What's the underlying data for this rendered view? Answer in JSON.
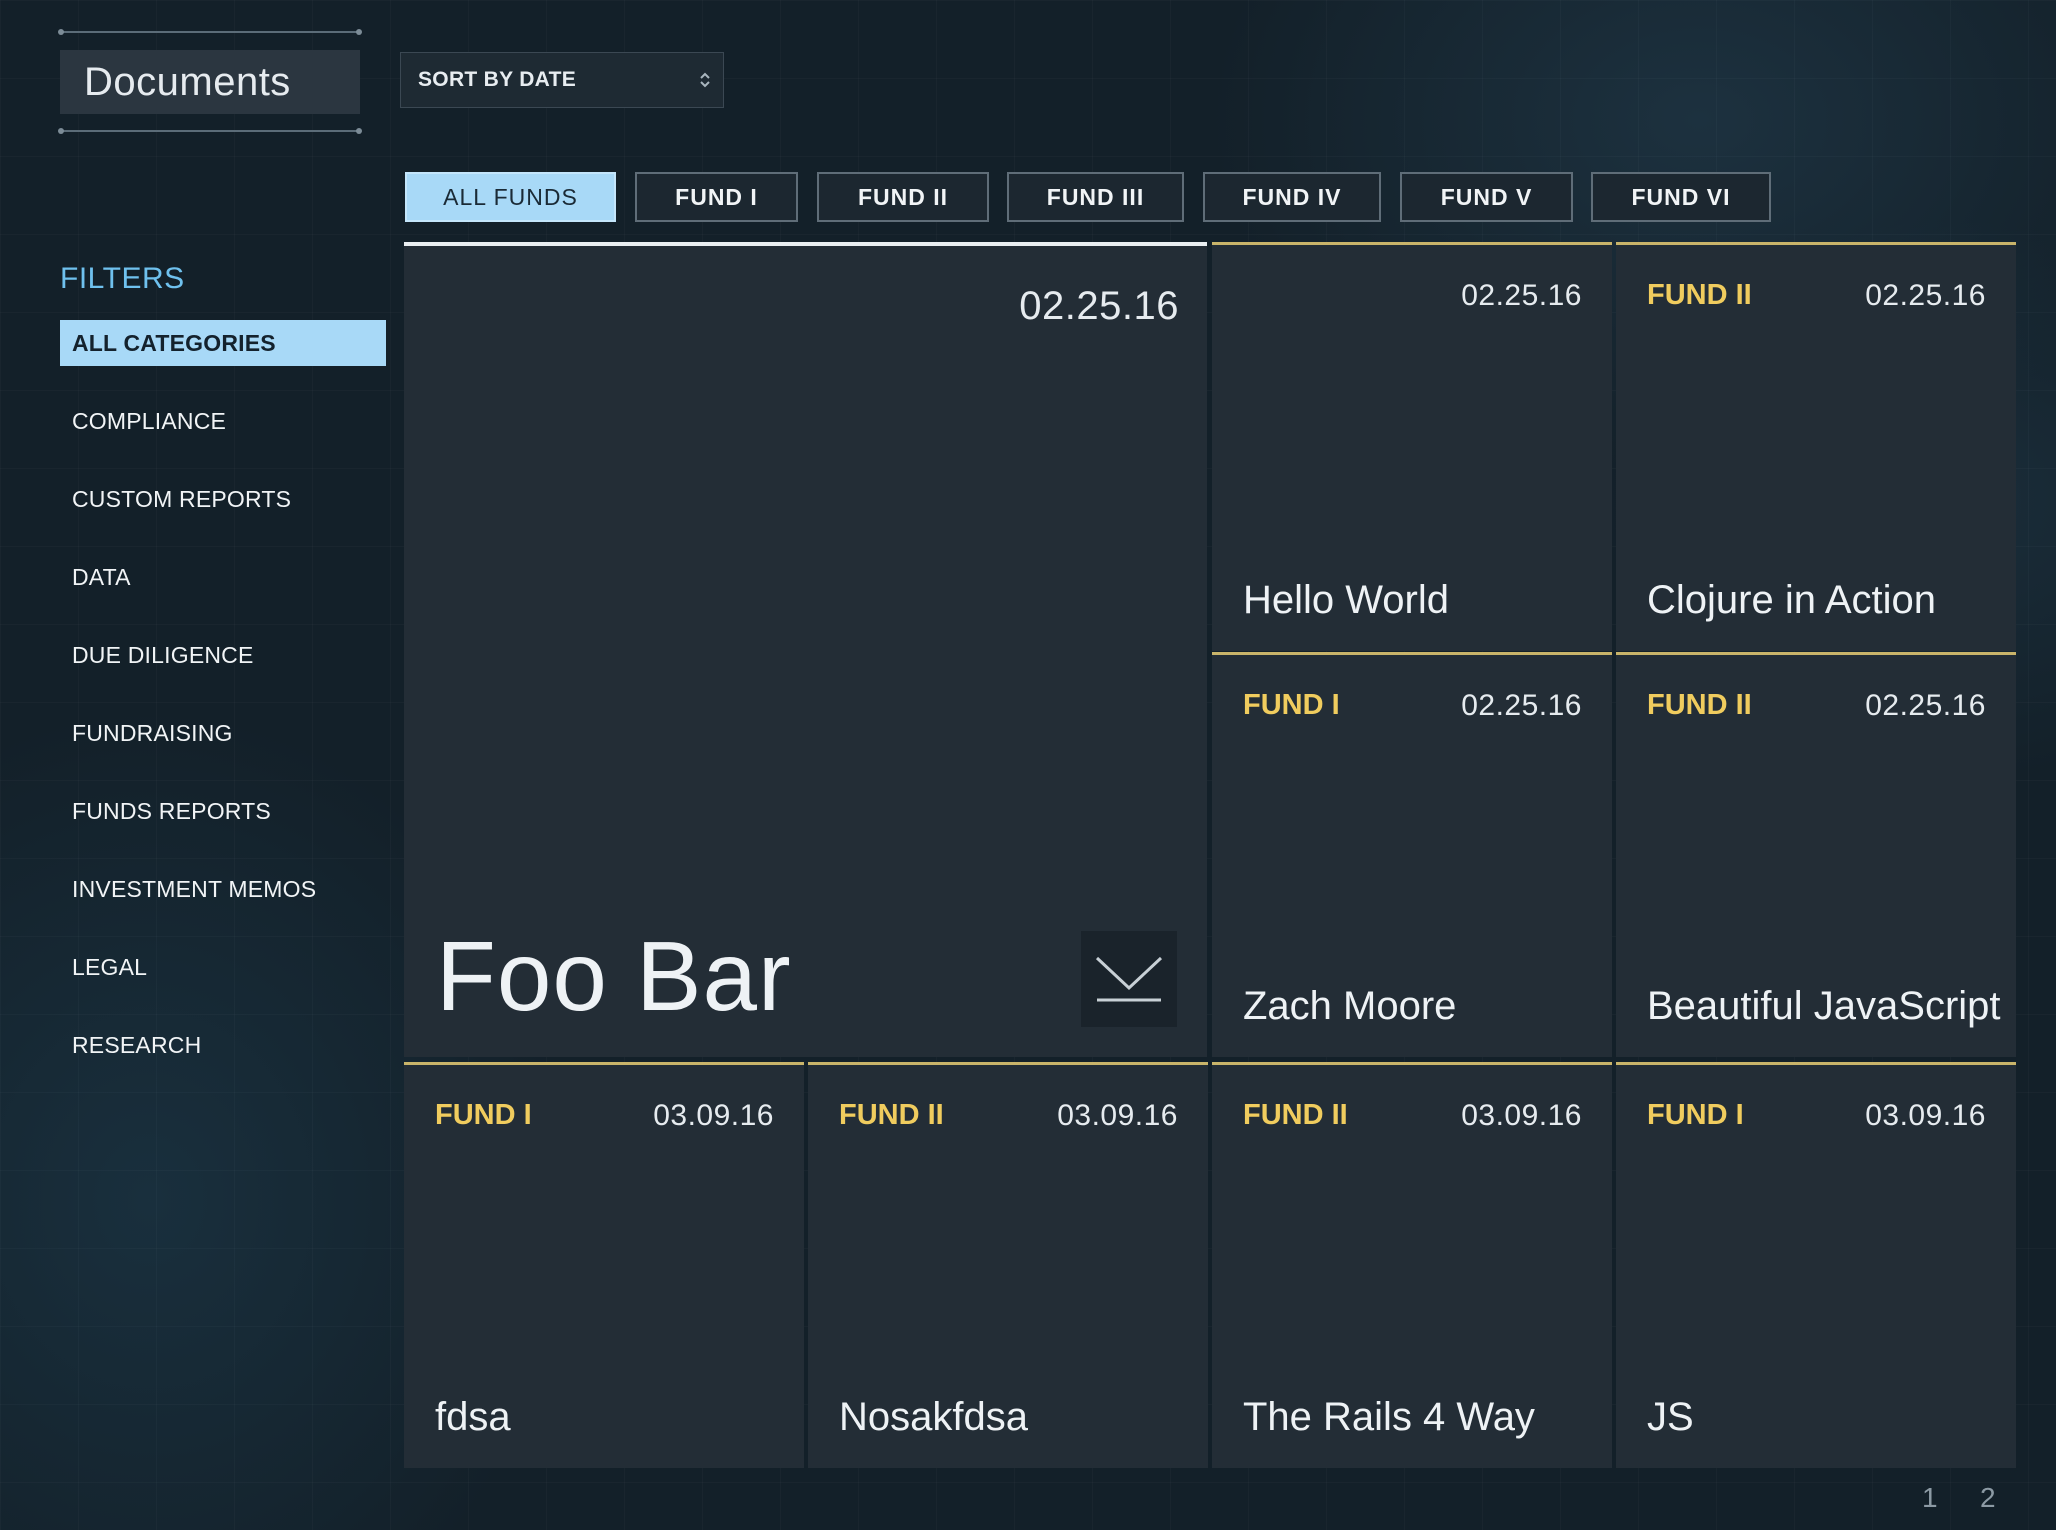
{
  "header": {
    "title": "Documents",
    "sort_label": "SORT BY DATE"
  },
  "fund_tabs": [
    {
      "label": "ALL FUNDS",
      "active": true
    },
    {
      "label": "FUND I"
    },
    {
      "label": "FUND II"
    },
    {
      "label": "FUND III"
    },
    {
      "label": "FUND IV"
    },
    {
      "label": "FUND V"
    },
    {
      "label": "FUND VI"
    }
  ],
  "filters": {
    "heading": "FILTERS",
    "items": [
      {
        "label": "ALL CATEGORIES",
        "active": true
      },
      {
        "label": "COMPLIANCE"
      },
      {
        "label": "CUSTOM REPORTS"
      },
      {
        "label": "DATA"
      },
      {
        "label": "DUE DILIGENCE"
      },
      {
        "label": "FUNDRAISING"
      },
      {
        "label": "FUNDS REPORTS"
      },
      {
        "label": "INVESTMENT MEMOS"
      },
      {
        "label": "LEGAL"
      },
      {
        "label": "RESEARCH"
      }
    ]
  },
  "documents": [
    {
      "fund": "",
      "date": "02.25.16",
      "title": "Foo Bar",
      "featured": true
    },
    {
      "fund": "",
      "date": "02.25.16",
      "title": "Hello World"
    },
    {
      "fund": "FUND II",
      "date": "02.25.16",
      "title": "Clojure in Action"
    },
    {
      "fund": "FUND I",
      "date": "02.25.16",
      "title": "Zach Moore"
    },
    {
      "fund": "FUND II",
      "date": "02.25.16",
      "title": "Beautiful JavaScript"
    },
    {
      "fund": "FUND I",
      "date": "03.09.16",
      "title": "fdsa"
    },
    {
      "fund": "FUND II",
      "date": "03.09.16",
      "title": "Nosakfdsa"
    },
    {
      "fund": "FUND II",
      "date": "03.09.16",
      "title": "The Rails 4 Way"
    },
    {
      "fund": "FUND I",
      "date": "03.09.16",
      "title": "JS"
    }
  ],
  "pagination": {
    "pages": [
      "1",
      "2"
    ]
  },
  "icons": {
    "download": "chevron-down-icon",
    "sort": "up-down-caret-icon"
  },
  "colors": {
    "accent_blue": "#a8d9f7",
    "filters_heading": "#6fc1ee",
    "fund_label": "#f0cc5e",
    "card_bg": "#232d36"
  }
}
